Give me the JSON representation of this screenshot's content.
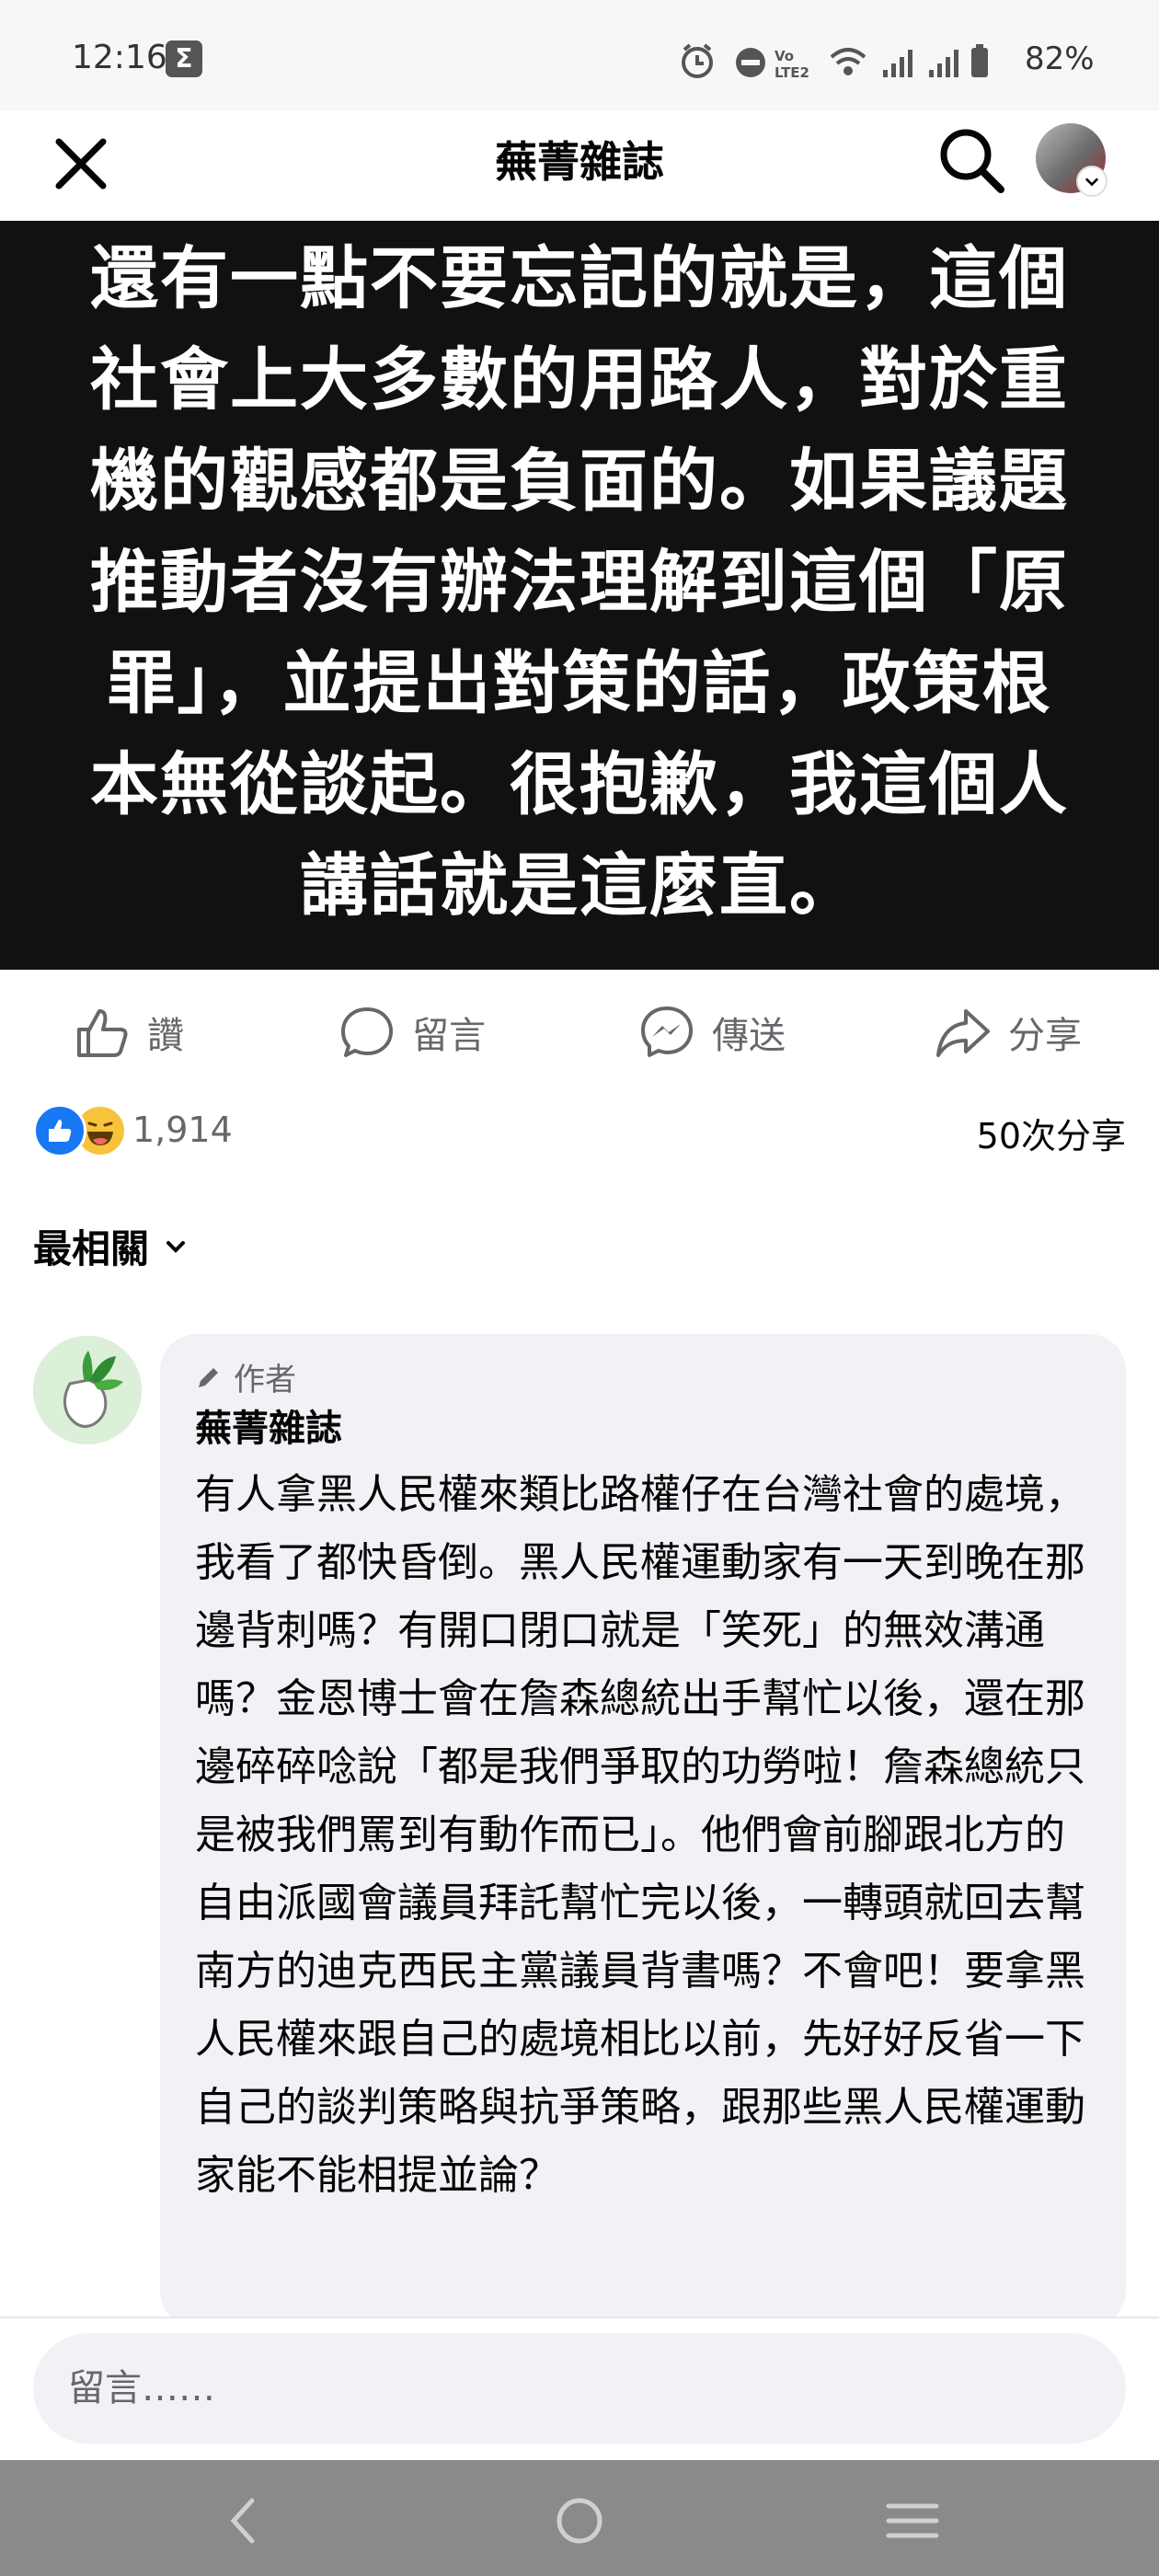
{
  "status_bar": {
    "time": "12:16",
    "network_label": "VoLTE LTE2",
    "battery": "82%",
    "icons": [
      "sigma-app-icon",
      "alarm-icon",
      "do-not-disturb-icon",
      "volte-icon",
      "wifi-icon",
      "signal-icon",
      "signal-icon-2",
      "battery-icon"
    ]
  },
  "header": {
    "title": "蕪菁雜誌",
    "close_icon": "close-icon",
    "search_icon": "search-icon"
  },
  "post_image": {
    "lines": [
      "還有一點不要忘記的就是，這個",
      "社會上大多數的用路人，對於重",
      "機的觀感都是負面的。如果議題",
      "推動者沒有辦法理解到這個「原",
      "罪」，並提出對策的話，政策根",
      "本無從談起。很抱歉，我這個人",
      "講話就是這麼直。"
    ]
  },
  "actions": {
    "like": "讚",
    "comment": "留言",
    "send": "傳送",
    "share": "分享"
  },
  "stats": {
    "reaction_count": "1,914",
    "share_count": "50次分享"
  },
  "sort": {
    "label": "最相關"
  },
  "comment": {
    "badge": "作者",
    "author": "蕪菁雜誌",
    "body": "有人拿黑人民權來類比路權仔在台灣社會的處境，我看了都快昏倒。黑人民權運動家有一天到晚在那邊背刺嗎？有開口閉口就是「笑死」的無效溝通嗎？金恩博士會在詹森總統出手幫忙以後，還在那邊碎碎唸說「都是我們爭取的功勞啦！詹森總統只是被我們罵到有動作而已」。他們會前腳跟北方的自由派國會議員拜託幫忙完以後，一轉頭就回去幫南方的迪克西民主黨議員背書嗎？不會吧！要拿黑人民權來跟自己的處境相比以前，先好好反省一下自己的談判策略與抗爭策略，跟那些黑人民權運動家能不能相提並論？"
  },
  "comment_input": {
    "placeholder": "留言……"
  },
  "colors": {
    "accent": "#1877f2",
    "text_secondary": "#65676b",
    "bubble": "#f0f2f5",
    "image_bg": "#111111"
  }
}
